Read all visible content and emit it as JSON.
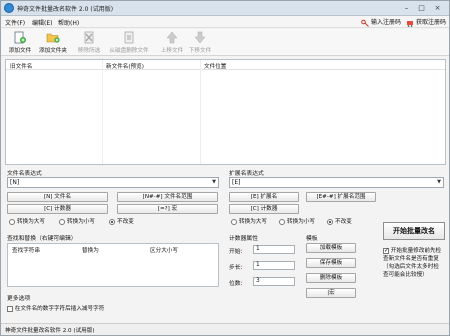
{
  "window": {
    "title": "神奇文件批量改名软件 2.0 (试用版)",
    "controls": [
      "–",
      "□",
      "×"
    ]
  },
  "menu": {
    "items": [
      "文件(F)",
      "编辑(E)",
      "帮助(H)"
    ],
    "register_label": "输入注册码",
    "get_code_label": "获取注册码"
  },
  "toolbar": {
    "buttons": [
      {
        "label": "添加文件",
        "icon": "add-file-icon",
        "enabled": true
      },
      {
        "label": "添加文件夹",
        "icon": "add-folder-icon",
        "enabled": true
      },
      {
        "label": "移除所选",
        "icon": "remove-icon",
        "enabled": false
      },
      {
        "label": "从磁盘删除文件",
        "icon": "delete-disk-icon",
        "enabled": false
      },
      {
        "label": "上移文件",
        "icon": "move-up-icon",
        "enabled": false
      },
      {
        "label": "下移文件",
        "icon": "move-down-icon",
        "enabled": false
      }
    ]
  },
  "file_list": {
    "columns": [
      "旧文件名",
      "新文件名(预览)",
      "文件位置"
    ]
  },
  "filename_expr": {
    "label": "文件名表达式",
    "value": "[N]",
    "buttons": [
      "[N] 文件名",
      "[N#-#] 文件名范围",
      "[C] 计数器",
      "[=?] 宏"
    ],
    "case_options": [
      "转换为大写",
      "转换为小写",
      "不改变"
    ],
    "case_selected": 2
  },
  "ext_expr": {
    "label": "扩展名表达式",
    "value": "[E]",
    "buttons": [
      "[E] 扩展名",
      "[E#-#] 扩展名范围",
      "[C] 计数器"
    ],
    "case_options": [
      "转换为大写",
      "转换为小写",
      "不改变"
    ],
    "case_selected": 2
  },
  "find_replace": {
    "label": "查找和替换（右键可编辑）",
    "columns": [
      "查找字符串",
      "替换为",
      "区分大小写"
    ]
  },
  "counter": {
    "label": "计数器属性",
    "start_label": "开始:",
    "start_value": "1",
    "step_label": "步长:",
    "step_value": "1",
    "digits_label": "位数:",
    "digits_value": "3"
  },
  "template": {
    "label": "模板",
    "buttons": [
      "加载模板",
      "保存模板",
      "删除模板",
      "|宏"
    ]
  },
  "more_options": {
    "label": "更多选项",
    "checkbox_label": "在文件名的数字字符后插入减号字符",
    "checked": false
  },
  "start": {
    "label": "开始批量改名",
    "note": "开始批量修改前先检查新文件名是否有重复（勾选后文件太多时检查可能会比较慢）",
    "note_checked": true
  },
  "status_bar": {
    "text": "神奇文件批量改名软件 2.0 (试用版)"
  },
  "colors": {
    "accent": "#2f8ad8",
    "titlebar": "#d8e2ec",
    "background": "#f3f3f3"
  }
}
